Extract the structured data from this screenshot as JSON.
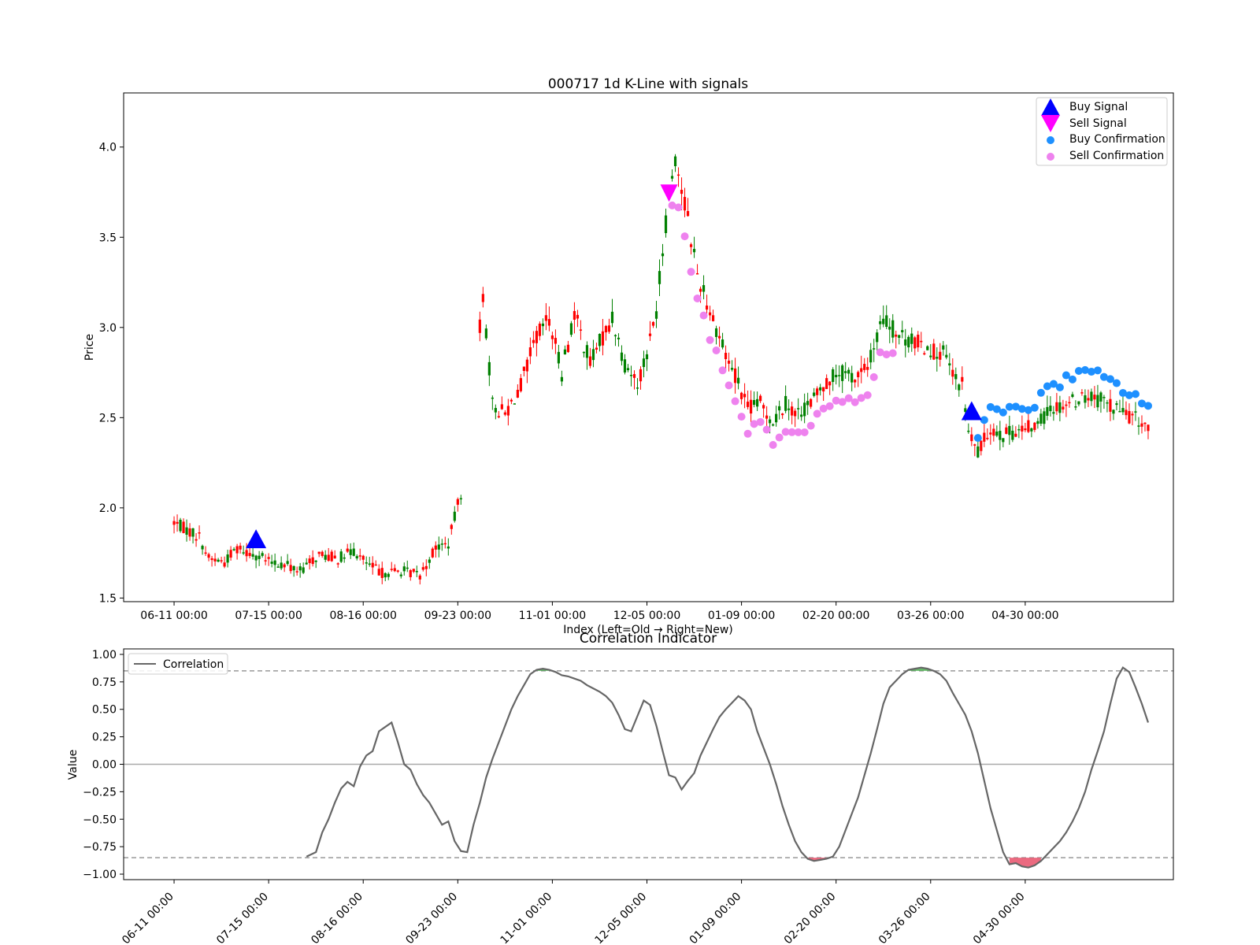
{
  "chart_data": [
    {
      "type": "candlestick",
      "title": "000717 1d K-Line with signals",
      "xlabel": "Index (Left=Old → Right=New)",
      "ylabel": "Price",
      "ylim": [
        1.48,
        4.3
      ],
      "xlim": [
        -16,
        317
      ],
      "yticks": [
        1.5,
        2.0,
        2.5,
        3.0,
        3.5,
        4.0
      ],
      "ytick_labels": [
        "1.5",
        "2.0",
        "2.5",
        "3.0",
        "3.5",
        "4.0"
      ],
      "xticks": [
        0,
        30,
        60,
        90,
        120,
        150,
        180,
        210,
        240,
        270
      ],
      "xtick_labels": [
        "06-11 00:00",
        "07-15 00:00",
        "08-16 00:00",
        "09-23 00:00",
        "11-01 00:00",
        "12-05 00:00",
        "01-09 00:00",
        "02-20 00:00",
        "03-26 00:00",
        "04-30 00:00"
      ],
      "grid": false,
      "legend_position": "top-right",
      "colors": {
        "up": "#008000",
        "down": "#ff0000",
        "buy_signal": "#0000ff",
        "sell_signal": "#ff00ff",
        "buy_confirmation": "#1e90ff",
        "sell_confirmation": "#ee82ee"
      },
      "legend": [
        "Buy Signal",
        "Sell Signal",
        "Buy Confirmation",
        "Sell Confirmation"
      ],
      "price_keypoints": [
        {
          "i": 0,
          "close": 1.92
        },
        {
          "i": 4,
          "close": 1.88
        },
        {
          "i": 8,
          "close": 1.84
        },
        {
          "i": 11,
          "close": 1.72
        },
        {
          "i": 16,
          "close": 1.7
        },
        {
          "i": 20,
          "close": 1.78
        },
        {
          "i": 26,
          "close": 1.74
        },
        {
          "i": 30,
          "close": 1.7
        },
        {
          "i": 36,
          "close": 1.68
        },
        {
          "i": 40,
          "close": 1.65
        },
        {
          "i": 46,
          "close": 1.74
        },
        {
          "i": 52,
          "close": 1.72
        },
        {
          "i": 57,
          "close": 1.76
        },
        {
          "i": 62,
          "close": 1.68
        },
        {
          "i": 66,
          "close": 1.64
        },
        {
          "i": 72,
          "close": 1.65
        },
        {
          "i": 78,
          "close": 1.63
        },
        {
          "i": 83,
          "close": 1.78
        },
        {
          "i": 87,
          "close": 1.8
        },
        {
          "i": 92,
          "close": 2.16
        },
        {
          "i": 98,
          "close": 3.18
        },
        {
          "i": 101,
          "close": 2.57
        },
        {
          "i": 105,
          "close": 2.52
        },
        {
          "i": 110,
          "close": 2.68
        },
        {
          "i": 115,
          "close": 2.95
        },
        {
          "i": 119,
          "close": 3.05
        },
        {
          "i": 123,
          "close": 2.75
        },
        {
          "i": 127,
          "close": 3.08
        },
        {
          "i": 132,
          "close": 2.8
        },
        {
          "i": 136,
          "close": 2.95
        },
        {
          "i": 139,
          "close": 3.05
        },
        {
          "i": 143,
          "close": 2.8
        },
        {
          "i": 147,
          "close": 2.7
        },
        {
          "i": 150,
          "close": 2.85
        },
        {
          "i": 153,
          "close": 3.1
        },
        {
          "i": 157,
          "close": 3.75
        },
        {
          "i": 159,
          "close": 3.95
        },
        {
          "i": 163,
          "close": 3.6
        },
        {
          "i": 166,
          "close": 3.3
        },
        {
          "i": 170,
          "close": 3.1
        },
        {
          "i": 175,
          "close": 2.85
        },
        {
          "i": 179,
          "close": 2.7
        },
        {
          "i": 182,
          "close": 2.55
        },
        {
          "i": 186,
          "close": 2.58
        },
        {
          "i": 190,
          "close": 2.48
        },
        {
          "i": 194,
          "close": 2.58
        },
        {
          "i": 198,
          "close": 2.52
        },
        {
          "i": 203,
          "close": 2.6
        },
        {
          "i": 207,
          "close": 2.7
        },
        {
          "i": 211,
          "close": 2.75
        },
        {
          "i": 216,
          "close": 2.72
        },
        {
          "i": 220,
          "close": 2.78
        },
        {
          "i": 225,
          "close": 3.05
        },
        {
          "i": 230,
          "close": 2.95
        },
        {
          "i": 235,
          "close": 2.92
        },
        {
          "i": 240,
          "close": 2.88
        },
        {
          "i": 244,
          "close": 2.85
        },
        {
          "i": 248,
          "close": 2.7
        },
        {
          "i": 250,
          "close": 2.68
        },
        {
          "i": 252,
          "close": 2.42
        },
        {
          "i": 255,
          "close": 2.3
        },
        {
          "i": 259,
          "close": 2.45
        },
        {
          "i": 263,
          "close": 2.4
        },
        {
          "i": 268,
          "close": 2.43
        },
        {
          "i": 273,
          "close": 2.45
        },
        {
          "i": 278,
          "close": 2.55
        },
        {
          "i": 283,
          "close": 2.58
        },
        {
          "i": 289,
          "close": 2.62
        },
        {
          "i": 294,
          "close": 2.6
        },
        {
          "i": 299,
          "close": 2.55
        },
        {
          "i": 304,
          "close": 2.5
        },
        {
          "i": 309,
          "close": 2.45
        }
      ],
      "buy_signals": [
        {
          "i": 26,
          "price": 1.82
        },
        {
          "i": 253,
          "price": 2.53
        }
      ],
      "sell_signals": [
        {
          "i": 157,
          "price": 3.74
        }
      ],
      "buy_confirmation_range": [
        255,
        310
      ],
      "sell_confirmation_range": [
        158,
        228
      ]
    },
    {
      "type": "line",
      "title": "Correlation Indicator",
      "xlabel": "",
      "ylabel": "Value",
      "ylim": [
        -1.05,
        1.05
      ],
      "xlim": [
        -16,
        317
      ],
      "yticks": [
        -1.0,
        -0.75,
        -0.5,
        -0.25,
        0.0,
        0.25,
        0.5,
        0.75,
        1.0
      ],
      "ytick_labels": [
        "−1.00",
        "−0.75",
        "−0.50",
        "−0.25",
        "0.00",
        "0.25",
        "0.50",
        "0.75",
        "1.00"
      ],
      "xticks": [
        0,
        30,
        60,
        90,
        120,
        150,
        180,
        210,
        240,
        270
      ],
      "xtick_labels": [
        "06-11 00:00",
        "07-15 00:00",
        "08-16 00:00",
        "09-23 00:00",
        "11-01 00:00",
        "12-05 00:00",
        "01-09 00:00",
        "02-20 00:00",
        "03-26 00:00",
        "04-30 00:00"
      ],
      "thresholds": [
        0.85,
        -0.85
      ],
      "grid": false,
      "legend_position": "top-left",
      "series": [
        {
          "name": "Correlation",
          "color": "#666666",
          "x": [
            42,
            45,
            47,
            49,
            51,
            53,
            55,
            57,
            59,
            61,
            63,
            65,
            67,
            69,
            71,
            73,
            75,
            77,
            79,
            81,
            83,
            85,
            87,
            89,
            91,
            93,
            95,
            97,
            99,
            101,
            103,
            105,
            107,
            109,
            111,
            113,
            115,
            117,
            119,
            121,
            123,
            125,
            127,
            129,
            131,
            133,
            135,
            137,
            139,
            141,
            143,
            145,
            147,
            149,
            151,
            153,
            155,
            157,
            159,
            161,
            163,
            165,
            167,
            169,
            171,
            173,
            175,
            177,
            179,
            181,
            183,
            185,
            187,
            189,
            191,
            193,
            195,
            197,
            199,
            201,
            203,
            205,
            207,
            209,
            211,
            213,
            215,
            217,
            219,
            221,
            223,
            225,
            227,
            229,
            231,
            233,
            235,
            237,
            239,
            241,
            243,
            245,
            247,
            249,
            251,
            253,
            255,
            257,
            259,
            261,
            263,
            265,
            267,
            269,
            271,
            273,
            275,
            277,
            279,
            281,
            283,
            285,
            287,
            289,
            291,
            293,
            295,
            297,
            299,
            301,
            303,
            305,
            307,
            309
          ],
          "y": [
            -0.84,
            -0.8,
            -0.62,
            -0.5,
            -0.35,
            -0.22,
            -0.16,
            -0.2,
            -0.02,
            0.08,
            0.12,
            0.3,
            0.34,
            0.38,
            0.2,
            0.0,
            -0.05,
            -0.18,
            -0.28,
            -0.35,
            -0.45,
            -0.55,
            -0.52,
            -0.7,
            -0.79,
            -0.8,
            -0.55,
            -0.35,
            -0.12,
            0.05,
            0.2,
            0.35,
            0.5,
            0.62,
            0.72,
            0.82,
            0.86,
            0.87,
            0.86,
            0.84,
            0.81,
            0.8,
            0.78,
            0.76,
            0.72,
            0.69,
            0.66,
            0.62,
            0.56,
            0.45,
            0.32,
            0.3,
            0.44,
            0.58,
            0.54,
            0.35,
            0.12,
            -0.1,
            -0.12,
            -0.23,
            -0.15,
            -0.08,
            0.08,
            0.2,
            0.32,
            0.43,
            0.5,
            0.56,
            0.62,
            0.58,
            0.5,
            0.3,
            0.15,
            0.0,
            -0.18,
            -0.38,
            -0.55,
            -0.7,
            -0.8,
            -0.86,
            -0.88,
            -0.87,
            -0.86,
            -0.84,
            -0.75,
            -0.6,
            -0.45,
            -0.3,
            -0.1,
            0.1,
            0.32,
            0.55,
            0.7,
            0.76,
            0.82,
            0.86,
            0.87,
            0.88,
            0.87,
            0.85,
            0.82,
            0.76,
            0.65,
            0.55,
            0.45,
            0.3,
            0.1,
            -0.15,
            -0.4,
            -0.6,
            -0.8,
            -0.91,
            -0.9,
            -0.93,
            -0.94,
            -0.92,
            -0.88,
            -0.82,
            -0.76,
            -0.7,
            -0.62,
            -0.52,
            -0.4,
            -0.25,
            -0.05,
            0.12,
            0.3,
            0.55,
            0.78,
            0.88,
            0.84,
            0.7,
            0.55,
            0.38
          ]
        }
      ]
    }
  ]
}
